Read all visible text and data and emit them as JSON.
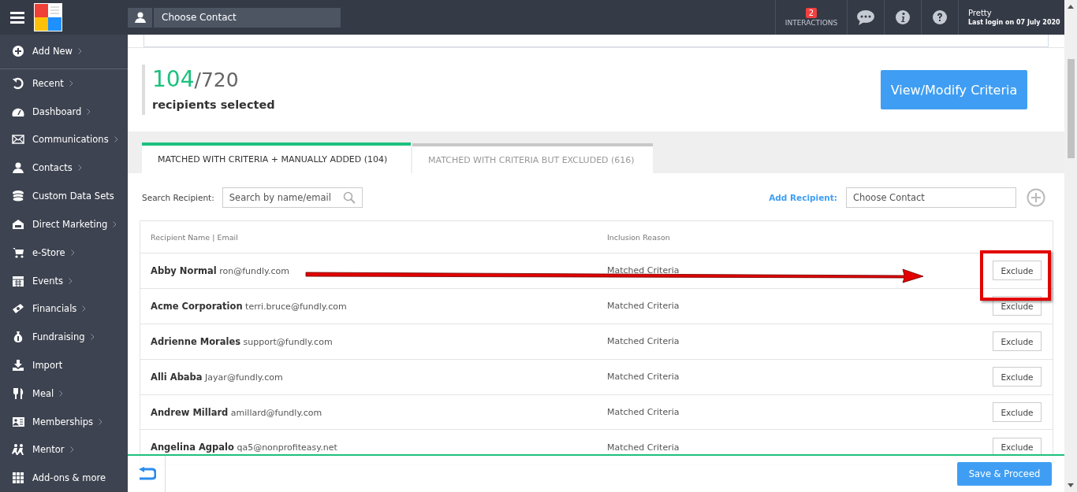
{
  "topbar": {
    "contact_field": {
      "placeholder": "Choose Contact"
    },
    "interactions": {
      "count": "2",
      "label": "INTERACTIONS"
    },
    "user": {
      "name": "Pretty",
      "last_login": "Last login on 07 July 2020"
    }
  },
  "sidebar": {
    "items": [
      {
        "label": "Add New",
        "submenu": true
      },
      {
        "label": "Recent",
        "submenu": true
      },
      {
        "label": "Dashboard",
        "submenu": true
      },
      {
        "label": "Communications",
        "submenu": true
      },
      {
        "label": "Contacts",
        "submenu": true
      },
      {
        "label": "Custom Data Sets",
        "submenu": false
      },
      {
        "label": "Direct Marketing",
        "submenu": true
      },
      {
        "label": "e-Store",
        "submenu": true
      },
      {
        "label": "Events",
        "submenu": true
      },
      {
        "label": "Financials",
        "submenu": true
      },
      {
        "label": "Fundraising",
        "submenu": true
      },
      {
        "label": "Import",
        "submenu": false
      },
      {
        "label": "Meal",
        "submenu": true
      },
      {
        "label": "Memberships",
        "submenu": true
      },
      {
        "label": "Mentor",
        "submenu": true
      },
      {
        "label": "Add-ons & more",
        "submenu": false
      }
    ]
  },
  "summary": {
    "selected": "104",
    "total": "/720",
    "caption": "recipients selected",
    "button": "View/Modify Criteria"
  },
  "tabs": [
    {
      "label": "MATCHED WITH CRITERIA + MANUALLY ADDED (104)",
      "selected": true
    },
    {
      "label": "MATCHED WITH CRITERIA BUT EXCLUDED (616)",
      "selected": false
    }
  ],
  "search": {
    "label": "Search Recipient:",
    "placeholder": "Search by name/email"
  },
  "add_recipient": {
    "label": "Add Recipient:",
    "placeholder": "Choose Contact"
  },
  "table": {
    "columns": [
      "Recipient Name | Email",
      "Inclusion Reason"
    ],
    "rows": [
      {
        "name": "Abby Normal",
        "email": "ron@fundly.com",
        "reason": "Matched Criteria",
        "action": "Exclude"
      },
      {
        "name": "Acme Corporation",
        "email": "terri.bruce@fundly.com",
        "reason": "Matched Criteria",
        "action": "Exclude"
      },
      {
        "name": "Adrienne Morales",
        "email": "support@fundly.com",
        "reason": "Matched Criteria",
        "action": "Exclude"
      },
      {
        "name": "Alli Ababa",
        "email": "Jayar@fundly.com",
        "reason": "Matched Criteria",
        "action": "Exclude"
      },
      {
        "name": "Andrew Millard",
        "email": "amillard@fundly.com",
        "reason": "Matched Criteria",
        "action": "Exclude"
      },
      {
        "name": "Angelina Agpalo",
        "email": "qa5@nonprofiteasy.net",
        "reason": "Matched Criteria",
        "action": "Exclude"
      }
    ]
  },
  "footer": {
    "button": "Save & Proceed"
  }
}
